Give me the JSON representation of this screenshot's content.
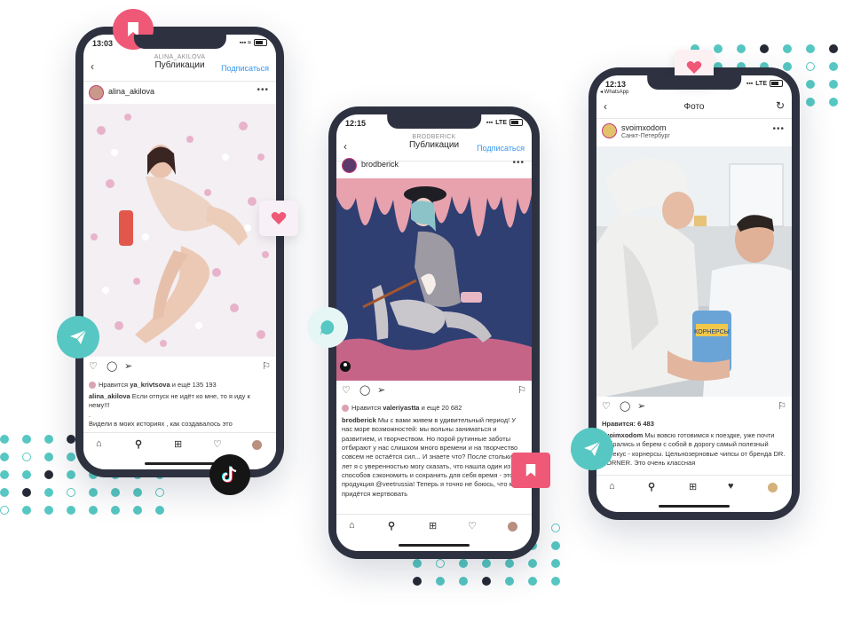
{
  "colors": {
    "teal": "#56c7c2",
    "pink": "#ef5877",
    "dark": "#262a36",
    "ig_blue": "#3897f0"
  },
  "phone1": {
    "time": "13:03",
    "nav_small": "ALINA_AKILOVA",
    "nav_title": "Публикации",
    "follow": "Подписаться",
    "username": "alina_akilova",
    "likes_prefix": "Нравится",
    "likes_user": "ya_krivtsova",
    "likes_suffix": "и ещё 135 193",
    "caption_user": "alina_akilova",
    "caption_text": "Если отпуск не идёт ко мне, то я иду к нему!!!",
    "caption_dot": ".",
    "caption_more": "Видели в моих историях , как создавалось это"
  },
  "phone2": {
    "time": "12:15",
    "network": "LTE",
    "nav_small": "BRODBERICK",
    "nav_title": "Публикации",
    "follow": "Подписаться",
    "username": "brodberick",
    "likes_prefix": "Нравится",
    "likes_user": "valeriyastta",
    "likes_suffix": "и ещё 20 682",
    "caption_user": "brodberick",
    "caption_text": "Мы с вами живем в удивительный период! У нас море возможностей: мы вольны заниматься и развитием, и творчеством. Но порой рутинные заботы отбирают у нас слишком много времени и на творчество совсем не остаётся сил... И знаете что? После стольких лет я с уверенностью могу сказать, что нашла один из способов сэкономить и сохранить для себя время - это продукция @veetrussia! Теперь я точно не боюсь, что мне придётся жертвовать"
  },
  "phone3": {
    "time": "12:13",
    "back_app": "◂ WhatsApp",
    "network": "LTE",
    "nav_title": "Фото",
    "username": "svoimxodom",
    "location": "Санкт-Петербург",
    "likes_label": "Нравится: 6 483",
    "caption_user": "svoimxodom",
    "caption_text": "Мы вовсю готовимся к поездке, уже почти собрались и берем с собой в дорогу самый полезный перекус - корнерсы. Цельнозерновые чипсы от бренда DR. KÖRNER. Это очень классная",
    "snack_label": "КОРНЕРСЫ"
  },
  "icons": [
    "heart-icon",
    "comment-icon",
    "share-icon",
    "bookmark-icon",
    "home-icon",
    "search-icon",
    "add-icon",
    "activity-icon",
    "profile-icon",
    "tiktok-icon",
    "paper-plane-icon",
    "chat-bubble-icon"
  ]
}
